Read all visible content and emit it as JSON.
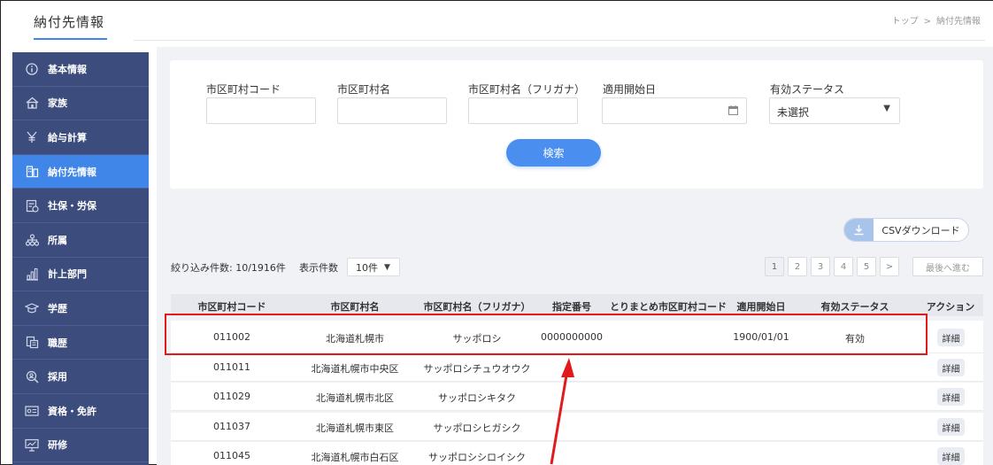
{
  "header": {
    "title": "納付先情報",
    "breadcrumb": [
      "トップ",
      ">",
      "納付先情報"
    ]
  },
  "sidebar": {
    "items": [
      {
        "label": "基本情報",
        "icon": "info-icon",
        "active": false
      },
      {
        "label": "家族",
        "icon": "house-icon",
        "active": false
      },
      {
        "label": "給与計算",
        "icon": "yen-icon",
        "active": false
      },
      {
        "label": "納付先情報",
        "icon": "building-icon",
        "active": true
      },
      {
        "label": "社保・労保",
        "icon": "insurance-icon",
        "active": false
      },
      {
        "label": "所属",
        "icon": "org-chart-icon",
        "active": false
      },
      {
        "label": "計上部門",
        "icon": "bar-chart-icon",
        "active": false
      },
      {
        "label": "学歴",
        "icon": "graduation-cap-icon",
        "active": false
      },
      {
        "label": "職歴",
        "icon": "briefcase-icon",
        "active": false
      },
      {
        "label": "採用",
        "icon": "recruit-icon",
        "active": false
      },
      {
        "label": "資格・免許",
        "icon": "certificate-icon",
        "active": false
      },
      {
        "label": "研修",
        "icon": "training-icon",
        "active": false
      }
    ]
  },
  "search": {
    "fields": {
      "code_label": "市区町村コード",
      "name_label": "市区町村名",
      "kana_label": "市区町村名（フリガナ）",
      "start_label": "適用開始日",
      "status_label": "有効ステータス"
    },
    "status_value": "未選択",
    "button": "検索"
  },
  "toolbar": {
    "csv_label": "CSVダウンロード",
    "count_text": "絞り込み件数: 10/1916件",
    "per_page_label": "表示件数",
    "per_page_value": "10件",
    "pages": [
      "1",
      "2",
      "3",
      "4",
      "5",
      ">"
    ],
    "last_label": "最後へ進む"
  },
  "table": {
    "headers": [
      "市区町村コード",
      "市区町村名",
      "市区町村名（フリガナ）",
      "指定番号",
      "とりまとめ市区町村コード",
      "適用開始日",
      "有効ステータス",
      "アクション"
    ],
    "rows": [
      {
        "code": "011002",
        "name": "北海道札幌市",
        "kana": "サッポロシ",
        "number": "0000000000",
        "summary_code": "",
        "start": "1900/01/01",
        "status": "有効",
        "action": "詳細"
      },
      {
        "code": "011011",
        "name": "北海道札幌市中央区",
        "kana": "サッポロシチュウオウク",
        "number": "",
        "summary_code": "",
        "start": "",
        "status": "",
        "action": "詳細"
      },
      {
        "code": "011029",
        "name": "北海道札幌市北区",
        "kana": "サッポロシキタク",
        "number": "",
        "summary_code": "",
        "start": "",
        "status": "",
        "action": "詳細"
      },
      {
        "code": "011037",
        "name": "北海道札幌市東区",
        "kana": "サッポロシヒガシク",
        "number": "",
        "summary_code": "",
        "start": "",
        "status": "",
        "action": "詳細"
      },
      {
        "code": "011045",
        "name": "北海道札幌市白石区",
        "kana": "サッポロシシロイシク",
        "number": "",
        "summary_code": "",
        "start": "",
        "status": "",
        "action": "詳細"
      }
    ]
  },
  "colors": {
    "sidebar": "#3c4d7d",
    "active": "#3f86e8",
    "highlight": "#e01b1b"
  }
}
